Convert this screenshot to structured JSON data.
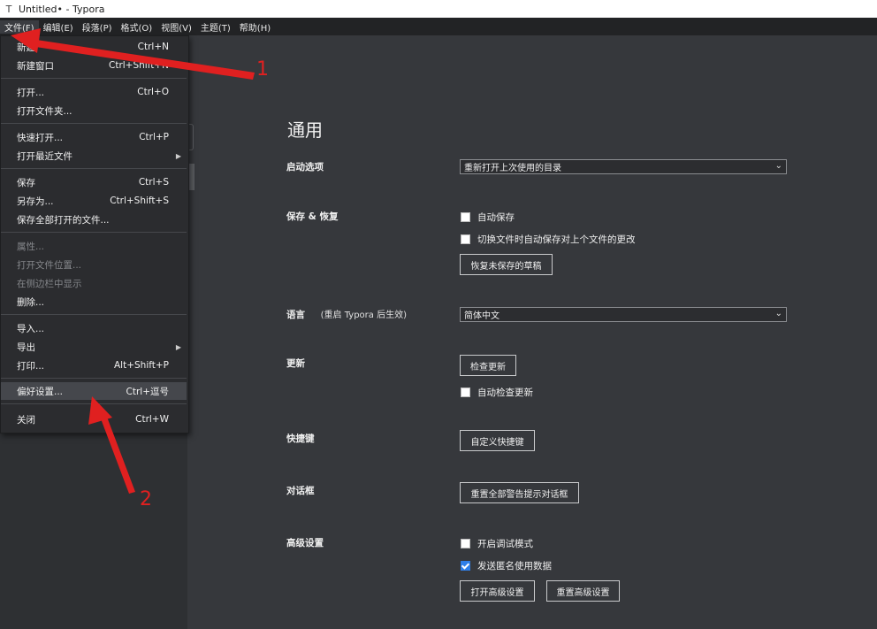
{
  "window": {
    "title": "Untitled• - Typora",
    "icon": "typora-t-icon"
  },
  "menubar": [
    {
      "label": "文件(F)"
    },
    {
      "label": "编辑(E)"
    },
    {
      "label": "段落(P)"
    },
    {
      "label": "格式(O)"
    },
    {
      "label": "视图(V)"
    },
    {
      "label": "主题(T)"
    },
    {
      "label": "帮助(H)"
    }
  ],
  "file_menu": {
    "items": [
      {
        "label": "新建",
        "shortcut": "Ctrl+N"
      },
      {
        "label": "新建窗口",
        "shortcut": "Ctrl+Shift+N"
      },
      {
        "label": "打开...",
        "shortcut": "Ctrl+O"
      },
      {
        "label": "打开文件夹...",
        "shortcut": ""
      },
      {
        "label": "快速打开...",
        "shortcut": "Ctrl+P"
      },
      {
        "label": "打开最近文件",
        "shortcut": ""
      },
      {
        "label": "保存",
        "shortcut": "Ctrl+S"
      },
      {
        "label": "另存为...",
        "shortcut": "Ctrl+Shift+S"
      },
      {
        "label": "保存全部打开的文件...",
        "shortcut": ""
      },
      {
        "label": "属性...",
        "shortcut": ""
      },
      {
        "label": "打开文件位置...",
        "shortcut": ""
      },
      {
        "label": "在侧边栏中显示",
        "shortcut": ""
      },
      {
        "label": "删除...",
        "shortcut": ""
      },
      {
        "label": "导入...",
        "shortcut": ""
      },
      {
        "label": "导出",
        "shortcut": ""
      },
      {
        "label": "打印...",
        "shortcut": "Alt+Shift+P"
      },
      {
        "label": "偏好设置...",
        "shortcut": "Ctrl+逗号"
      },
      {
        "label": "关闭",
        "shortcut": "Ctrl+W"
      }
    ]
  },
  "settings": {
    "heading": "通用",
    "startup": {
      "label": "启动选项",
      "selected": "重新打开上次使用的目录"
    },
    "save_restore": {
      "label": "保存 & 恢复",
      "autosave": "自动保存",
      "autosave_checked": false,
      "switch_autosave": "切换文件时自动保存对上个文件的更改",
      "switch_autosave_checked": false,
      "recover_button": "恢复未保存的草稿"
    },
    "language": {
      "label": "语言",
      "note": "(重启 Typora 后生效)",
      "selected": "简体中文"
    },
    "update": {
      "label": "更新",
      "check_button": "检查更新",
      "auto_check": "自动检查更新",
      "auto_check_checked": false
    },
    "shortcuts": {
      "label": "快捷键",
      "button": "自定义快捷键"
    },
    "dialogs": {
      "label": "对话框",
      "button": "重置全部警告提示对话框"
    },
    "advanced": {
      "label": "高级设置",
      "debug": "开启调试模式",
      "debug_checked": false,
      "telemetry": "发送匿名使用数据",
      "telemetry_checked": true,
      "open_button": "打开高级设置",
      "reset_button": "重置高级设置"
    }
  },
  "annotations": {
    "arrow1_label": "1",
    "arrow2_label": "2",
    "color": "#e02020"
  }
}
